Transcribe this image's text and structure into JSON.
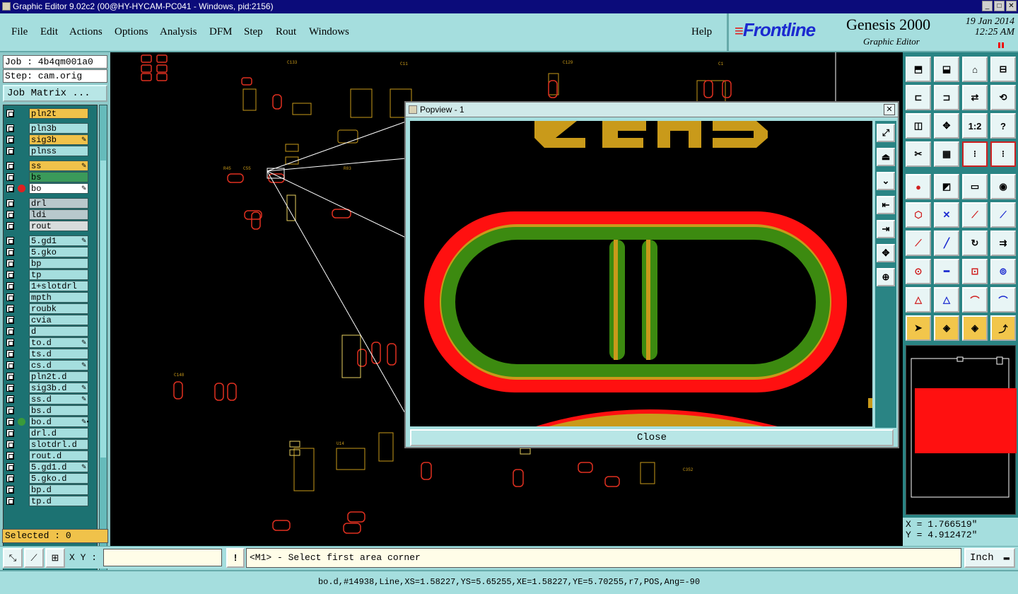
{
  "window": {
    "title": "Graphic Editor 9.02c2 (00@HY-HYCAM-PC041 - Windows, pid:2156)"
  },
  "menu": {
    "items": [
      "File",
      "Edit",
      "Actions",
      "Options",
      "Analysis",
      "DFM",
      "Step",
      "Rout",
      "Windows"
    ],
    "help": "Help"
  },
  "brand": {
    "logo": "Frontline",
    "product": "Genesis 2000",
    "subtitle": "Graphic Editor",
    "date": "19 Jan 2014",
    "time": "12:25 AM"
  },
  "job": {
    "job_label": "Job : 4b4qm001a0",
    "step_label": "Step: cam.orig",
    "matrix_button": "Job Matrix ..."
  },
  "layers": [
    {
      "name": "pln2t",
      "color": "#f0c24a",
      "mark": ""
    },
    {
      "name": "pln3b",
      "color": "#a5dede",
      "mark": ""
    },
    {
      "name": "sig3b",
      "color": "#f0c24a",
      "mark": "✎"
    },
    {
      "name": "plnss",
      "color": "#a5dede",
      "mark": ""
    },
    {
      "name": "ss",
      "color": "#f0c24a",
      "mark": "✎"
    },
    {
      "name": "bs",
      "color": "#3a9a5a",
      "mark": ""
    },
    {
      "name": "bo",
      "color": "#ffffff",
      "mark": "✎",
      "dot": "#e02020"
    },
    {
      "name": "drl",
      "color": "#b8c8cc",
      "mark": ""
    },
    {
      "name": "ldi",
      "color": "#b8c8cc",
      "mark": ""
    },
    {
      "name": "rout",
      "color": "#d8dcdc",
      "mark": ""
    },
    {
      "name": "5.gd1",
      "color": "#a5dede",
      "mark": "✎"
    },
    {
      "name": "5.gko",
      "color": "#a5dede",
      "mark": ""
    },
    {
      "name": "bp",
      "color": "#a5dede",
      "mark": ""
    },
    {
      "name": "tp",
      "color": "#a5dede",
      "mark": ""
    },
    {
      "name": "1+slotdrl",
      "color": "#a5dede",
      "mark": ""
    },
    {
      "name": "mpth",
      "color": "#a5dede",
      "mark": ""
    },
    {
      "name": "roubk",
      "color": "#a5dede",
      "mark": ""
    },
    {
      "name": "cvia",
      "color": "#a5dede",
      "mark": ""
    },
    {
      "name": "d",
      "color": "#a5dede",
      "mark": ""
    },
    {
      "name": "to.d",
      "color": "#a5dede",
      "mark": "✎"
    },
    {
      "name": "ts.d",
      "color": "#a5dede",
      "mark": ""
    },
    {
      "name": "cs.d",
      "color": "#a5dede",
      "mark": "✎"
    },
    {
      "name": "pln2t.d",
      "color": "#a5dede",
      "mark": ""
    },
    {
      "name": "sig3b.d",
      "color": "#a5dede",
      "mark": "✎"
    },
    {
      "name": "ss.d",
      "color": "#a5dede",
      "mark": "✎"
    },
    {
      "name": "bs.d",
      "color": "#a5dede",
      "mark": ""
    },
    {
      "name": "bo.d",
      "color": "#a5dede",
      "mark": "✎▪",
      "dot": "#3a9a3a"
    },
    {
      "name": "drl.d",
      "color": "#a5dede",
      "mark": ""
    },
    {
      "name": "slotdrl.d",
      "color": "#a5dede",
      "mark": ""
    },
    {
      "name": "rout.d",
      "color": "#a5dede",
      "mark": ""
    },
    {
      "name": "5.gd1.d",
      "color": "#a5dede",
      "mark": "✎"
    },
    {
      "name": "5.gko.d",
      "color": "#a5dede",
      "mark": ""
    },
    {
      "name": "bp.d",
      "color": "#a5dede",
      "mark": ""
    },
    {
      "name": "tp.d",
      "color": "#a5dede",
      "mark": ""
    }
  ],
  "selected": "Selected : 0",
  "popview": {
    "title": "Popview - 1",
    "close_label": "Close"
  },
  "coords": {
    "x": "X = 1.766519\"",
    "y": "Y = 4.912472\""
  },
  "command": {
    "xy_label": "X Y :",
    "xy_value": "",
    "prompt": "<M1> - Select first area corner",
    "unit": "Inch"
  },
  "status": "bo.d,#14938,Line,XS=1.58227,YS=5.65255,XE=1.58227,YE=5.70255,r7,POS,Ang=-90",
  "toolbar": {
    "labels": {
      "ratio": "1:2",
      "help": "?"
    },
    "icons": [
      "open-icon",
      "save-icon",
      "home-icon",
      "window-icon",
      "prev-icon",
      "next-icon",
      "swap-icon",
      "redraw-icon",
      "fit-icon",
      "zoom-icon",
      "ratio-icon",
      "help-icon",
      "pan-icon",
      "grid-icon",
      "traffic-light-icon",
      "layers-icon",
      "select-icon",
      "arc-icon",
      "measure-icon",
      "snap-icon",
      "connect-icon",
      "cross-icon",
      "line-icon",
      "line-select-icon",
      "angle-icon",
      "slash-icon",
      "rotate-icon",
      "flip-icon",
      "pad-icon",
      "minus-icon",
      "resize-icon",
      "circles-icon",
      "tri-icon",
      "tri2-icon",
      "arch-icon",
      "arch2-icon",
      "pointer-icon",
      "pointer-box-icon",
      "pointer-box2-icon",
      "route-icon"
    ]
  }
}
